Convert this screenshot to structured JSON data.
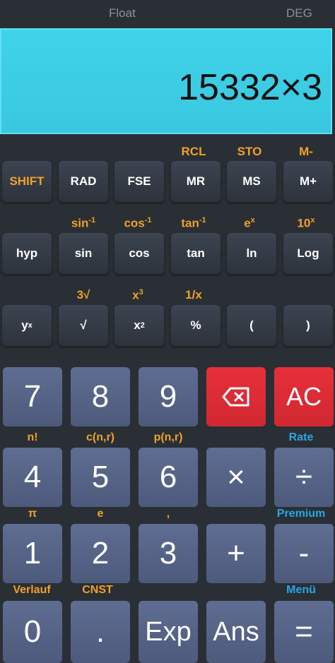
{
  "status": {
    "mode": "Float",
    "angle": "DEG"
  },
  "display": {
    "expression": "15332×3"
  },
  "sci_row1": {
    "labels": [
      "RCL",
      "STO",
      "M-"
    ],
    "buttons": [
      "SHIFT",
      "RAD",
      "FSE",
      "MR",
      "MS",
      "M+"
    ]
  },
  "sci_row2": {
    "labels": [
      "sin",
      "cos",
      "tan",
      "e",
      "10"
    ],
    "sup": [
      "-1",
      "-1",
      "-1",
      "x",
      "x"
    ],
    "buttons": [
      "hyp",
      "sin",
      "cos",
      "tan",
      "ln",
      "Log"
    ]
  },
  "sci_row3": {
    "labels": [
      "3√",
      "x",
      "1/x"
    ],
    "label_sup": "3",
    "buttons": [
      "y",
      "√",
      "x",
      "%",
      "(",
      ")"
    ],
    "button_sup": [
      "x",
      "2"
    ]
  },
  "num": {
    "row1": [
      "7",
      "8",
      "9",
      "AC"
    ],
    "row2_labels": [
      "n!",
      "c(n,r)",
      "p(n,r)",
      "Rate"
    ],
    "row2": [
      "4",
      "5",
      "6",
      "×",
      "÷"
    ],
    "row3_labels": [
      "π",
      "e",
      ",",
      "Premium"
    ],
    "row3": [
      "1",
      "2",
      "3",
      "+",
      "-"
    ],
    "row4_labels": [
      "Verlauf",
      "CNST",
      "Menü"
    ],
    "row4": [
      "0",
      ".",
      "Exp",
      "Ans",
      "="
    ]
  },
  "colors": {
    "accent": "#f0a12a",
    "blue": "#28a6e6",
    "danger": "#e62f3a",
    "display": "#3fd3ea"
  }
}
